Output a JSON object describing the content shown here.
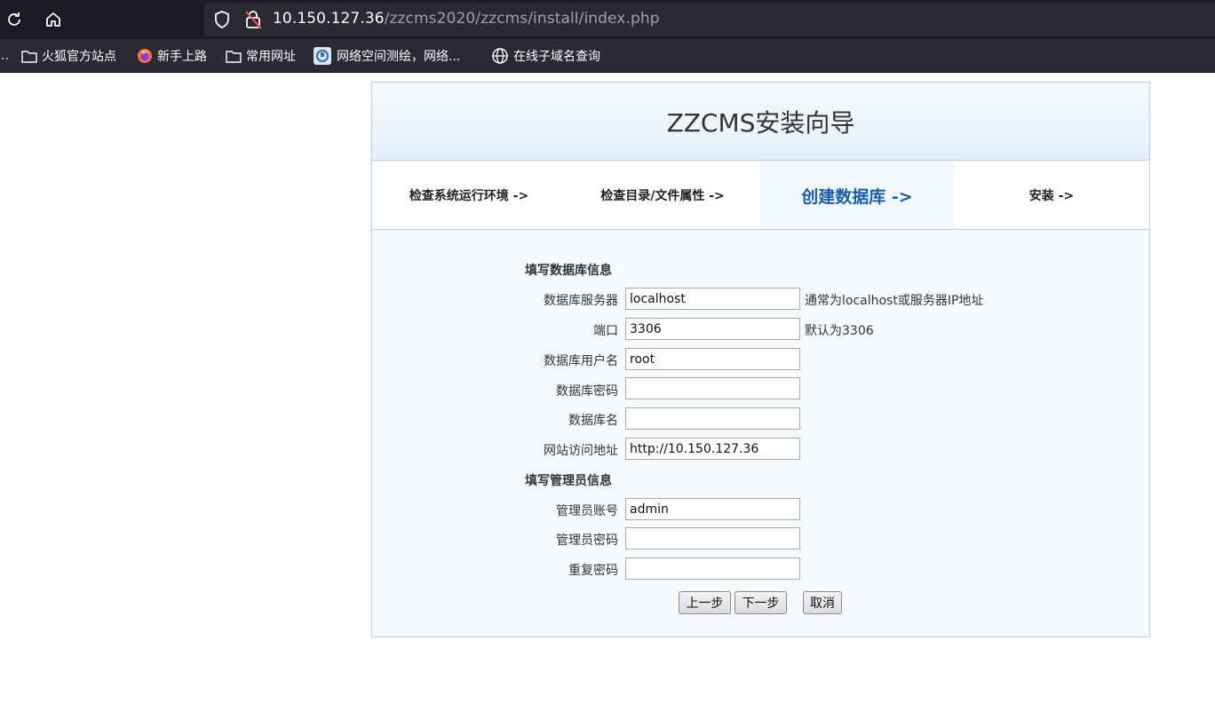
{
  "browser": {
    "url_host": "10.150.127.36",
    "url_path": "/zzcms2020/zzcms/install/index.php",
    "bookmarks": [
      {
        "label": "火狐官方站点",
        "icon": "folder-icon"
      },
      {
        "label": "新手上路",
        "icon": "firefox-icon"
      },
      {
        "label": "常用网址",
        "icon": "folder-icon"
      },
      {
        "label": "网络空间测绘，网络...",
        "icon": "site-icon"
      },
      {
        "label": "在线子域名查询",
        "icon": "globe-icon"
      }
    ],
    "overflow": ".."
  },
  "installer": {
    "title": "ZZCMS安装向导",
    "steps": [
      {
        "label": "检查系统运行环境 ->",
        "active": false
      },
      {
        "label": "检查目录/文件属性 ->",
        "active": false
      },
      {
        "label": "创建数据库 ->",
        "active": true
      },
      {
        "label": "安装 ->",
        "active": false
      }
    ],
    "db_section_title": "填写数据库信息",
    "db_fields": [
      {
        "label": "数据库服务器",
        "value": "localhost",
        "hint": "通常为localhost或服务器IP地址"
      },
      {
        "label": "端口",
        "value": "3306",
        "hint": "默认为3306"
      },
      {
        "label": "数据库用户名",
        "value": "root",
        "hint": ""
      },
      {
        "label": "数据库密码",
        "value": "",
        "hint": ""
      },
      {
        "label": "数据库名",
        "value": "",
        "hint": ""
      },
      {
        "label": "网站访问地址",
        "value": "http://10.150.127.36",
        "hint": ""
      }
    ],
    "admin_section_title": "填写管理员信息",
    "admin_fields": [
      {
        "label": "管理员账号",
        "value": "admin"
      },
      {
        "label": "管理员密码",
        "value": ""
      },
      {
        "label": "重复密码",
        "value": ""
      }
    ],
    "buttons": {
      "prev": "上一步",
      "next": "下一步",
      "cancel": "取消"
    }
  }
}
